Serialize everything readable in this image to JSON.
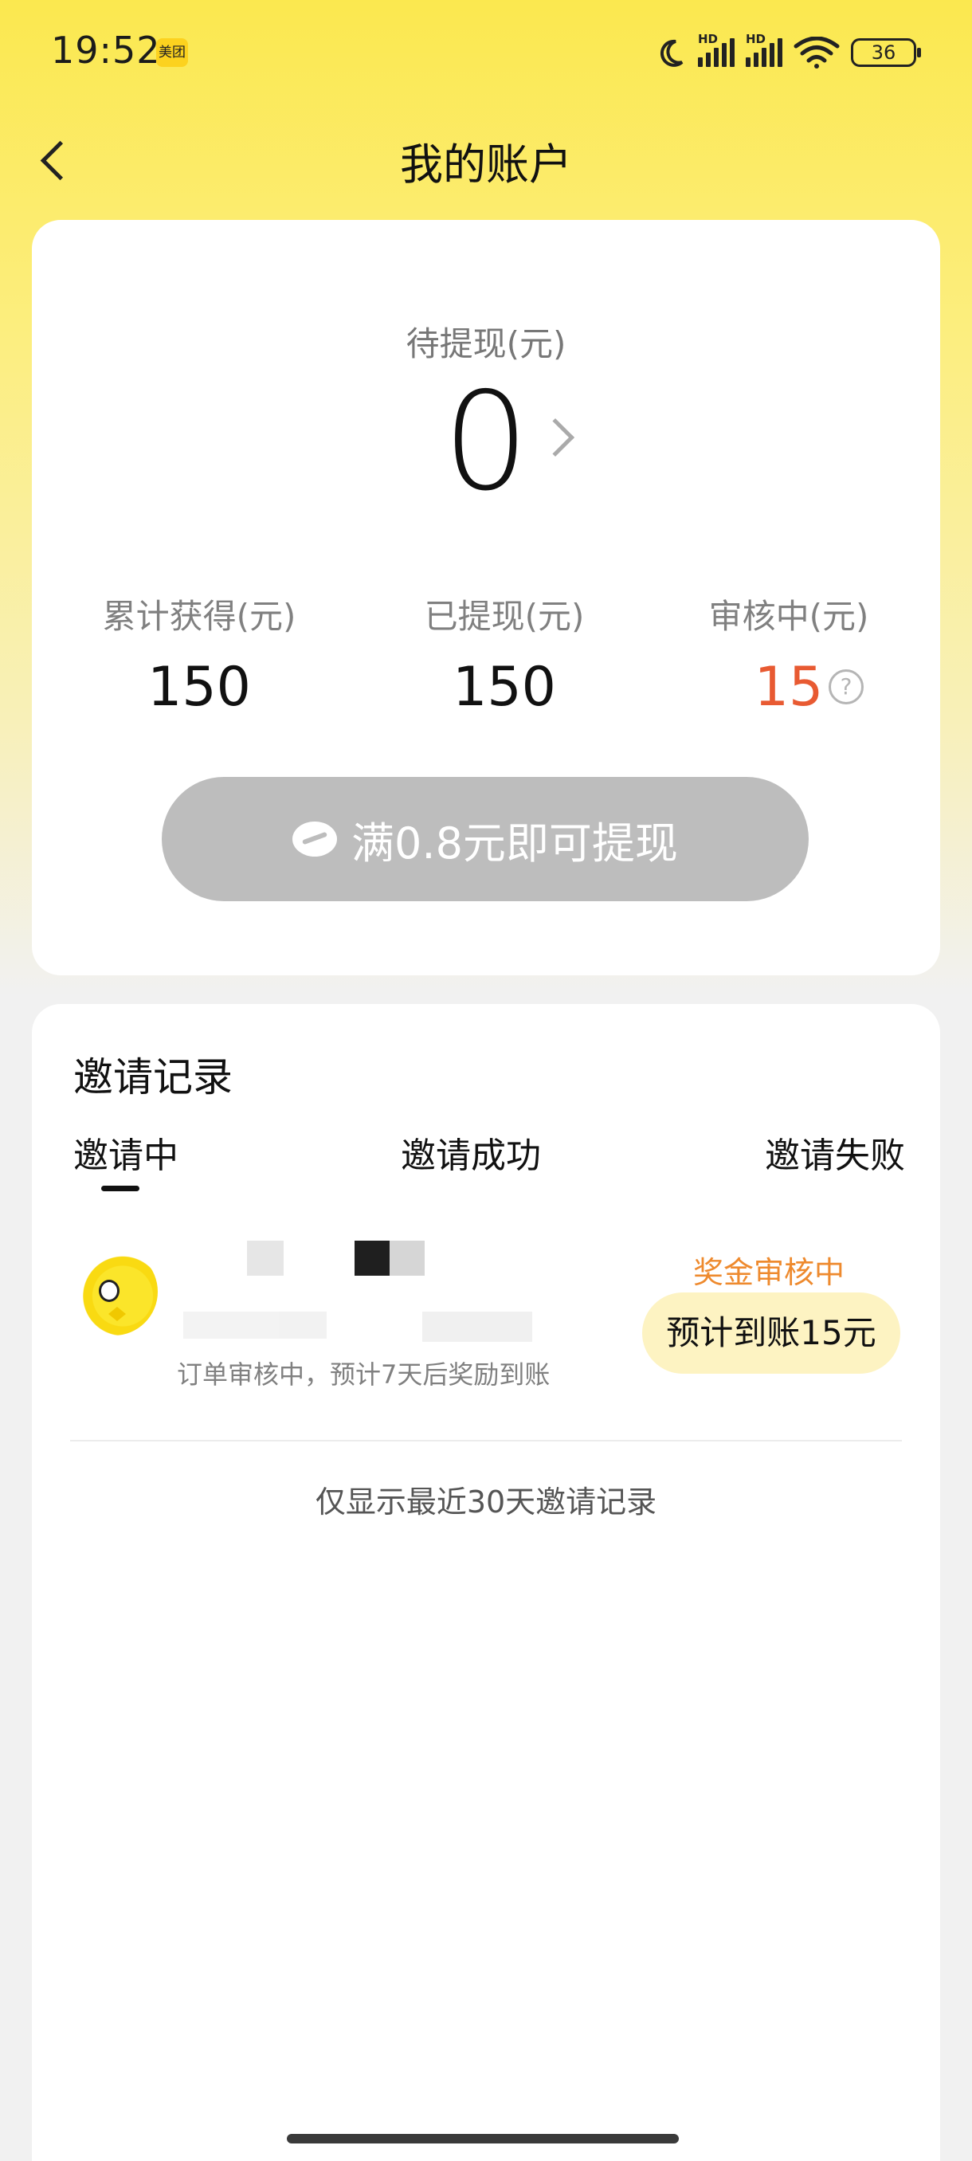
{
  "status_bar": {
    "time": "19:52",
    "app_badge": "美团",
    "hd1": "HD",
    "hd2": "HD",
    "battery": "36",
    "icons": [
      "moon-icon",
      "signal-icon",
      "signal-icon",
      "wifi-icon",
      "battery-icon"
    ]
  },
  "nav": {
    "title": "我的账户",
    "back_icon": "chevron-left-icon"
  },
  "account": {
    "pending_label": "待提现(元)",
    "pending_value": "0",
    "stats": [
      {
        "label": "累计获得(元)",
        "value": "150"
      },
      {
        "label": "已提现(元)",
        "value": "150"
      },
      {
        "label": "审核中(元)",
        "value": "15"
      }
    ],
    "help_glyph": "?",
    "withdraw_button": "满0.8元即可提现",
    "colors": {
      "reviewing": "#e85a32",
      "button_disabled": "#bdbdbd"
    }
  },
  "invite": {
    "title": "邀请记录",
    "tabs": [
      "邀请中",
      "邀请成功",
      "邀请失败"
    ],
    "active_tab": 0,
    "records": [
      {
        "description": "订单审核中，预计7天后奖励到账",
        "status": "奖金审核中",
        "reward": "预计到账15元"
      }
    ],
    "footer_note": "仅显示最近30天邀请记录",
    "colors": {
      "status": "#ee8a2e",
      "pill": "#fdf3c2"
    }
  }
}
